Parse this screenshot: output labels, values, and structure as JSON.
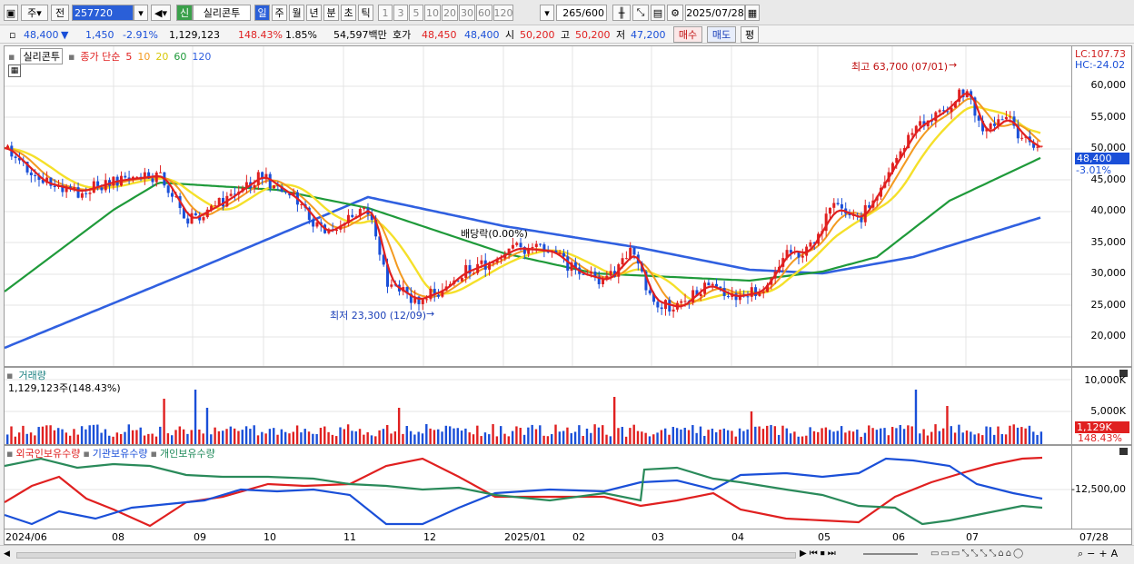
{
  "toolbar": {
    "menu1": "주",
    "menu2": "전",
    "code": "257720",
    "badge": "신",
    "stock_name": "실리콘투",
    "periods": [
      "일",
      "주",
      "월",
      "년",
      "분",
      "초",
      "틱"
    ],
    "minutes": [
      "1",
      "3",
      "5",
      "10",
      "20",
      "30",
      "60",
      "120"
    ],
    "count": "265",
    "count_total": "/600",
    "date": "2025/07/28"
  },
  "info": {
    "price": "48,400",
    "arrow": "▼",
    "change": "1,450",
    "change_pct": "-2.91%",
    "volume": "1,129,123",
    "vol_ratio": "148.43%",
    "turnover": "1.85%",
    "amount": "54,597백만",
    "ask_label": "호가",
    "ask": "48,450",
    "bid": "48,400",
    "open_label": "시",
    "open": "50,200",
    "high_label": "고",
    "high": "50,200",
    "low_label": "저",
    "low": "47,200",
    "buy_btn": "매수",
    "sell_btn": "매도",
    "eval_btn": "평"
  },
  "price_panel": {
    "title": "실리콘투",
    "legend_main": "종가 단순",
    "ma_labels": [
      "5",
      "10",
      "20",
      "60",
      "120"
    ],
    "lc": "LC:107.73",
    "hc": "HC:-24.02",
    "y_ticks": [
      "60,000",
      "55,000",
      "50,000",
      "45,000",
      "40,000",
      "35,000",
      "30,000",
      "25,000",
      "20,000"
    ],
    "current_price": "48,400",
    "current_pct": "-3.01%",
    "ann_high": "최고 63,700 (07/01)",
    "ann_low": "최저 23,300 (12/09)",
    "ann_div": "배당락(0.00%)"
  },
  "volume_panel": {
    "title": "거래량",
    "value": "1,129,123주(148.43%)",
    "y_ticks": [
      "10,000K",
      "5,000K"
    ],
    "current": "1,129K",
    "current_pct": "148.43%"
  },
  "holder_panel": {
    "legend": [
      "외국인보유수량",
      "기관보유수량",
      "개인보유수량"
    ],
    "y_tick": "-12,500,00"
  },
  "x_axis": [
    "2024/06",
    "08",
    "09",
    "10",
    "11",
    "12",
    "2025/01",
    "02",
    "03",
    "04",
    "05",
    "06",
    "07",
    "07/28"
  ],
  "colors": {
    "up": "#e02020",
    "down": "#1a4fd8",
    "ma5": "#e02020",
    "ma10": "#f39a20",
    "ma20": "#f5e02a",
    "ma60": "#1f9a3a",
    "ma120": "#3060e0"
  }
}
